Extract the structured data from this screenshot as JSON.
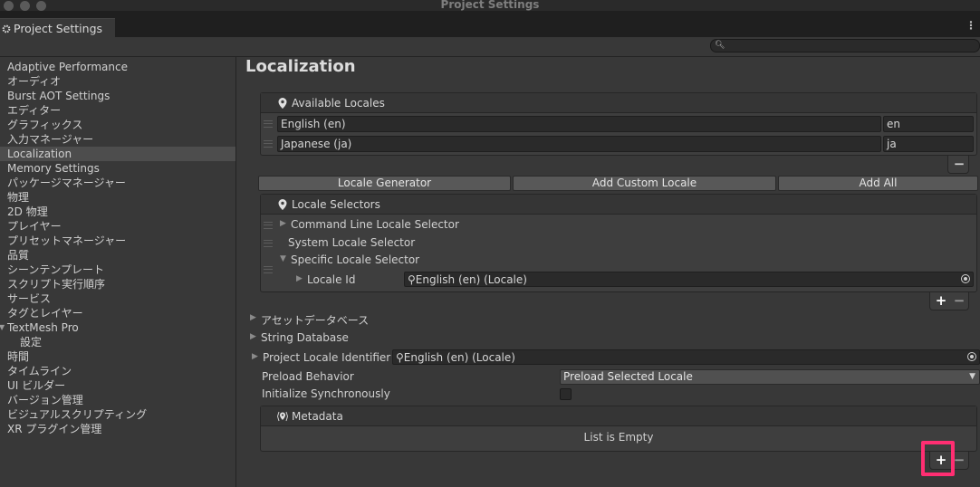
{
  "window": {
    "title": "Project Settings"
  },
  "tab": {
    "label": "Project Settings"
  },
  "sidebar": {
    "items": [
      {
        "label": "Adaptive Performance"
      },
      {
        "label": "オーディオ"
      },
      {
        "label": "Burst AOT Settings"
      },
      {
        "label": "エディター"
      },
      {
        "label": "グラフィックス"
      },
      {
        "label": "入力マネージャー"
      },
      {
        "label": "Localization"
      },
      {
        "label": "Memory Settings"
      },
      {
        "label": "パッケージマネージャー"
      },
      {
        "label": "物理"
      },
      {
        "label": "2D 物理"
      },
      {
        "label": "プレイヤー"
      },
      {
        "label": "プリセットマネージャー"
      },
      {
        "label": "品質"
      },
      {
        "label": "シーンテンプレート"
      },
      {
        "label": "スクリプト実行順序"
      },
      {
        "label": "サービス"
      },
      {
        "label": "タグとレイヤー"
      },
      {
        "label": "TextMesh Pro"
      },
      {
        "label": "設定"
      },
      {
        "label": "時間"
      },
      {
        "label": "タイムライン"
      },
      {
        "label": "UI ビルダー"
      },
      {
        "label": "バージョン管理"
      },
      {
        "label": "ビジュアルスクリプティング"
      },
      {
        "label": "XR プラグイン管理"
      }
    ],
    "selected": "Localization"
  },
  "main": {
    "title": "Localization",
    "available_locales": {
      "header": "Available Locales",
      "rows": [
        {
          "name": "English (en)",
          "code": "en"
        },
        {
          "name": "Japanese (ja)",
          "code": "ja"
        }
      ],
      "remove_label": "−"
    },
    "buttons": {
      "locale_generator": "Locale Generator",
      "add_custom_locale": "Add Custom Locale",
      "add_all": "Add All"
    },
    "locale_selectors": {
      "header": "Locale Selectors",
      "items": [
        {
          "label": "Command Line Locale Selector"
        },
        {
          "label": "System Locale Selector"
        },
        {
          "label": "Specific Locale Selector"
        }
      ],
      "locale_id_label": "Locale Id",
      "locale_id_value": "English (en) (Locale)",
      "add_label": "+",
      "remove_label": "−"
    },
    "foldouts": {
      "asset_database": "アセットデータベース",
      "string_database": "String Database",
      "project_locale_identifier": "Project Locale Identifier",
      "project_locale_value": "English (en) (Locale)"
    },
    "preload": {
      "label": "Preload Behavior",
      "value": "Preload Selected Locale"
    },
    "initialize_sync": {
      "label": "Initialize Synchronously",
      "checked": false
    },
    "metadata": {
      "header": "Metadata",
      "empty_text": "List is Empty",
      "add_label": "+",
      "remove_label": "−"
    }
  },
  "colors": {
    "highlight": "#ff2e72",
    "selected_bg": "#4d4d4d"
  }
}
